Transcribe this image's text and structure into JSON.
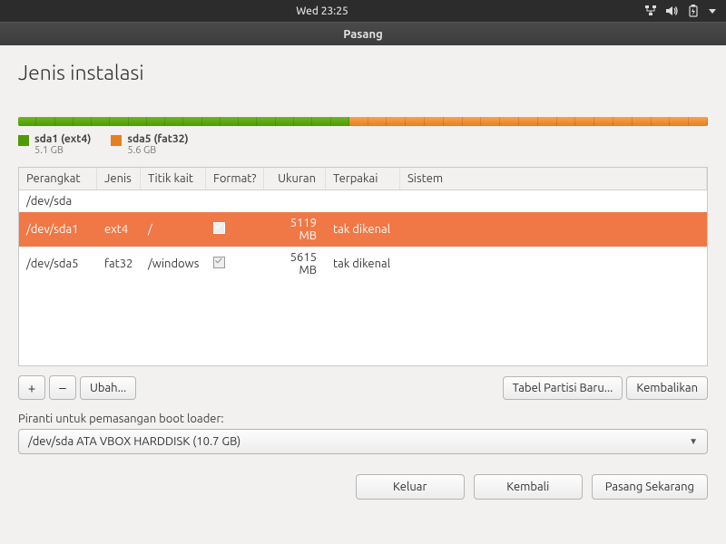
{
  "topbar": {
    "datetime": "Wed 23:25"
  },
  "window": {
    "title": "Pasang"
  },
  "page": {
    "heading": "Jenis instalasi"
  },
  "strip": {
    "segments": [
      {
        "color": "green",
        "width_pct": 48
      },
      {
        "color": "orange",
        "width_pct": 52
      }
    ]
  },
  "legend": [
    {
      "swatch": "green",
      "label": "sda1 (ext4)",
      "sub": "5.1 GB"
    },
    {
      "swatch": "orange",
      "label": "sda5 (fat32)",
      "sub": "5.6 GB"
    }
  ],
  "table": {
    "columns": {
      "device": "Perangkat",
      "type": "Jenis",
      "mount": "Titik kait",
      "format": "Format?",
      "size": "Ukuran",
      "used": "Terpakai",
      "system": "Sistem"
    },
    "disk_row": "/dev/sda",
    "rows": [
      {
        "device": "/dev/sda1",
        "type": "ext4",
        "mount": "/",
        "format": true,
        "size": "5119 MB",
        "used": "tak dikenal",
        "system": "",
        "selected": true
      },
      {
        "device": "/dev/sda5",
        "type": "fat32",
        "mount": "/windows",
        "format": true,
        "size": "5615 MB",
        "used": "tak dikenal",
        "system": "",
        "selected": false
      }
    ]
  },
  "buttons": {
    "add": "+",
    "remove": "–",
    "change": "Ubah...",
    "new_table": "Tabel Partisi Baru...",
    "revert": "Kembalikan",
    "quit": "Keluar",
    "back": "Kembali",
    "install": "Pasang Sekarang"
  },
  "bootloader": {
    "label": "Piranti untuk pemasangan boot loader:",
    "value": "/dev/sda   ATA VBOX HARDDISK (10.7 GB)"
  }
}
